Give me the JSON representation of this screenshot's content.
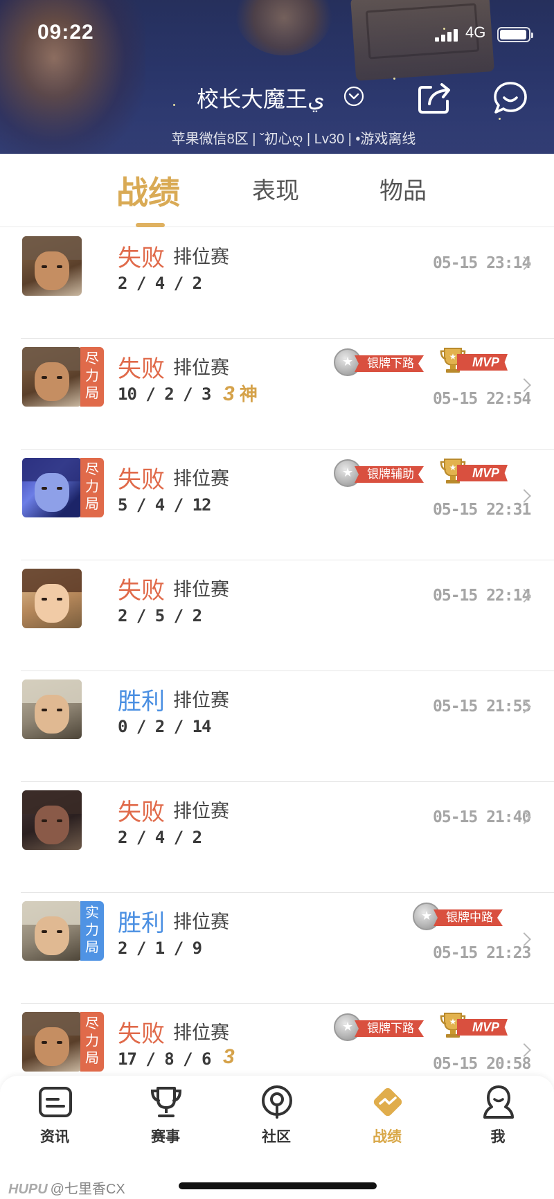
{
  "status_bar": {
    "time": "09:22",
    "network": "4G"
  },
  "profile": {
    "username": "校长大魔王ي",
    "info": "苹果微信8区 | ˇ初心ღ | Lv30 | •游戏离线"
  },
  "tabs": [
    {
      "label": "战绩",
      "active": true
    },
    {
      "label": "表现",
      "active": false
    },
    {
      "label": "物品",
      "active": false
    }
  ],
  "matches": [
    {
      "result": "失败",
      "type": "排位赛",
      "kda": "2 / 4 / 2",
      "time": "05-15 23:14",
      "tag": "",
      "streak_num": "",
      "streak_text": "",
      "badge": "",
      "mvp": false,
      "hero": "warrior-brown"
    },
    {
      "result": "失败",
      "type": "排位赛",
      "kda": "10 / 2 / 3",
      "time": "05-15 22:54",
      "tag": "尽力局",
      "streak_num": "3",
      "streak_text": "神",
      "badge": "银牌下路",
      "mvp": true,
      "hero": "warrior-brown"
    },
    {
      "result": "失败",
      "type": "排位赛",
      "kda": "5 / 4 / 12",
      "time": "05-15 22:31",
      "tag": "尽力局",
      "streak_num": "",
      "streak_text": "",
      "badge": "银牌辅助",
      "mvp": true,
      "hero": "mecha-blue"
    },
    {
      "result": "失败",
      "type": "排位赛",
      "kda": "2 / 5 / 2",
      "time": "05-15 22:14",
      "tag": "",
      "streak_num": "",
      "streak_text": "",
      "badge": "",
      "mvp": false,
      "hero": "lady-gold"
    },
    {
      "result": "胜利",
      "type": "排位赛",
      "kda": "0 / 2 / 14",
      "time": "05-15 21:55",
      "tag": "",
      "streak_num": "",
      "streak_text": "",
      "badge": "",
      "mvp": false,
      "hero": "silver-hair"
    },
    {
      "result": "失败",
      "type": "排位赛",
      "kda": "2 / 4 / 2",
      "time": "05-15 21:40",
      "tag": "",
      "streak_num": "",
      "streak_text": "",
      "badge": "",
      "mvp": false,
      "hero": "beast-dark"
    },
    {
      "result": "胜利",
      "type": "排位赛",
      "kda": "2 / 1 / 9",
      "time": "05-15 21:23",
      "tag": "实力局",
      "streak_num": "",
      "streak_text": "",
      "badge": "银牌中路",
      "mvp": false,
      "hero": "silver-hair"
    },
    {
      "result": "失败",
      "type": "排位赛",
      "kda": "17 / 8 / 6",
      "time": "05-15 20:58",
      "tag": "尽力局",
      "streak_num": "3",
      "streak_text": "",
      "badge": "银牌下路",
      "mvp": true,
      "hero": "warrior-brown"
    }
  ],
  "labels": {
    "mvp": "MVP"
  },
  "bottom_nav": [
    {
      "label": "资讯",
      "icon": "news-icon",
      "active": false
    },
    {
      "label": "赛事",
      "icon": "trophy-icon",
      "active": false
    },
    {
      "label": "社区",
      "icon": "community-icon",
      "active": false
    },
    {
      "label": "战绩",
      "icon": "record-icon",
      "active": true
    },
    {
      "label": "我",
      "icon": "profile-icon",
      "active": false
    }
  ],
  "watermark": {
    "brand": "HUPU",
    "author": "@七里香CX"
  },
  "colors": {
    "accent": "#d9aa55",
    "lose": "#e06a4a",
    "win": "#4a8fe2",
    "tag_red": "#e06a4a",
    "tag_blue": "#4f93e4"
  }
}
